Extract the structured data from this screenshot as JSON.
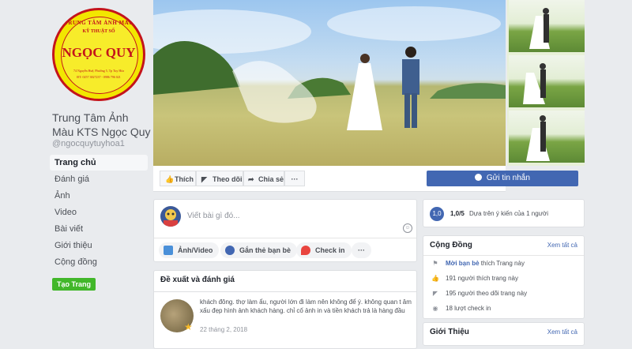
{
  "page": {
    "logo": {
      "top_arc": "TRUNG TÂM ẢNH MÀU",
      "subtitle": "KỸ THUẬT SỐ",
      "name": "NGỌC QUY",
      "address": "74 Nguyễn Huệ, Phường 5, Tp Tuy Hòa",
      "phone": "ĐT: 0257 3827237 - 0986 796 021"
    },
    "name": "Trung Tâm Ảnh Màu KTS Ngọc Quy",
    "handle": "@ngocquytuyhoa1"
  },
  "nav": {
    "items": [
      "Trang chủ",
      "Đánh giá",
      "Ảnh",
      "Video",
      "Bài viết",
      "Giới thiệu",
      "Cộng đồng"
    ],
    "create_label": "Tạo Trang"
  },
  "actions": {
    "like": "Thích",
    "follow": "Theo dõi",
    "share": "Chia sẻ",
    "more": "···",
    "send": "Gửi tin nhắn"
  },
  "composer": {
    "placeholder": "Viết bài gì đó...",
    "photo_video": "Ảnh/Video",
    "tag_friends": "Gắn thẻ bạn bè",
    "check_in": "Check in",
    "more": "···"
  },
  "reviews": {
    "title": "Đề xuất và đánh giá",
    "text": "khách đông. thợ làm ẩu, người lớn đi làm nên không để ý. không quan t âm xấu đẹp hình ảnh khách hàng. chỉ cố ảnh in và tiền khách trả là hàng đầu",
    "date": "22 tháng 2, 2018"
  },
  "rating": {
    "badge": "1,0",
    "score": "1,0/5",
    "desc": "Dựa trên ý kiến của 1 người"
  },
  "community": {
    "title": "Cộng Đồng",
    "see_all": "Xem tất cả",
    "invite_link": "Mời bạn bè",
    "invite_rest": " thích Trang này",
    "likes": "191 người thích trang này",
    "follows": "195 người theo dõi trang này",
    "checkins": "18 lượt check in"
  },
  "intro": {
    "title": "Giới Thiệu",
    "see_all": "Xem tất cả"
  },
  "colors": {
    "brand_blue": "#4267b2",
    "green": "#42b72a",
    "logo_red": "#c4141b",
    "logo_yellow": "#f2e600"
  }
}
